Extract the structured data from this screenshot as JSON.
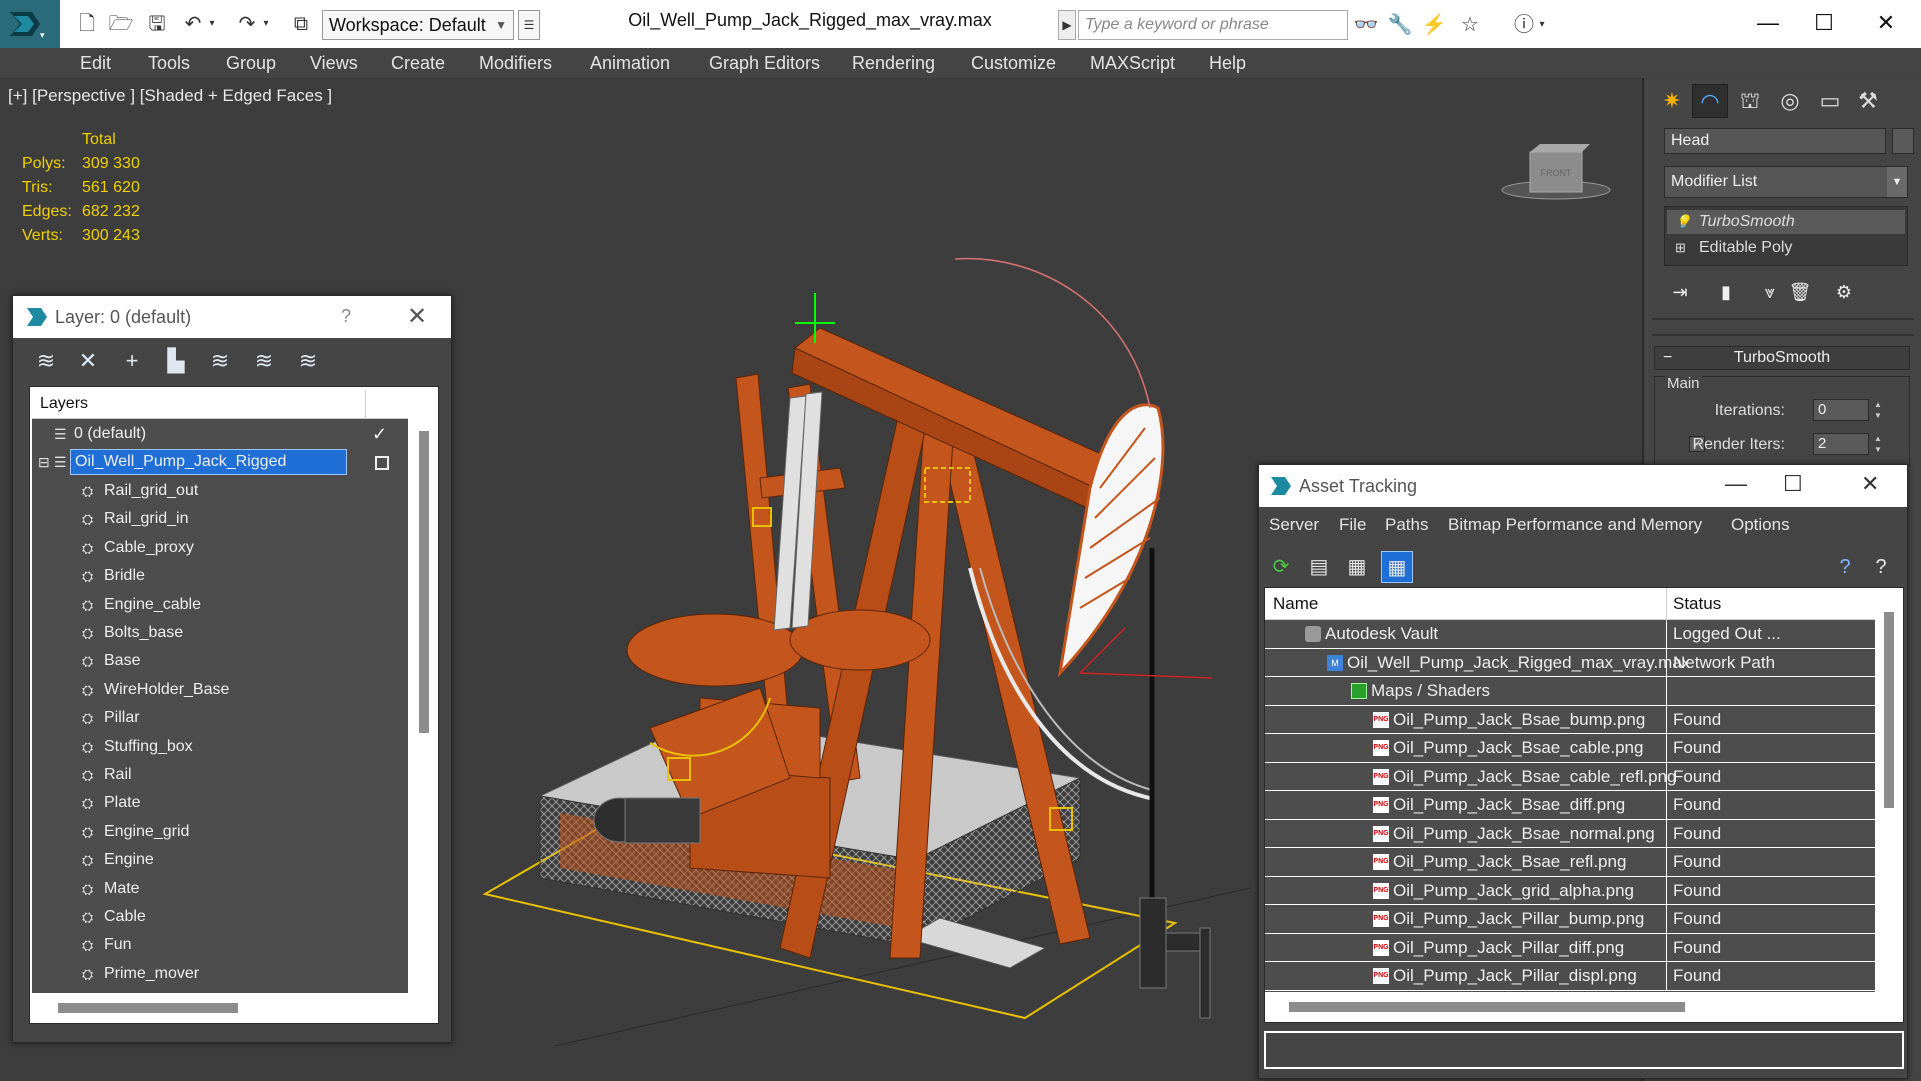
{
  "window": {
    "title": "Oil_Well_Pump_Jack_Rigged_max_vray.max",
    "workspace": "Workspace: Default",
    "search_placeholder": "Type a keyword or phrase"
  },
  "menu": [
    "Edit",
    "Tools",
    "Group",
    "Views",
    "Create",
    "Modifiers",
    "Animation",
    "Graph Editors",
    "Rendering",
    "Customize",
    "MAXScript",
    "Help"
  ],
  "viewport": {
    "label": "[+] [Perspective ] [Shaded + Edged Faces ]",
    "stats": {
      "total_label": "Total",
      "rows": [
        {
          "label": "Polys:",
          "value": "309 330"
        },
        {
          "label": "Tris:",
          "value": "561 620"
        },
        {
          "label": "Edges:",
          "value": "682 232"
        },
        {
          "label": "Verts:",
          "value": "300 243"
        }
      ]
    },
    "viewcube_text": "FRONT",
    "colors": {
      "stats": "#f0d000",
      "background": "#3d3d3d",
      "model": "#c4551c"
    }
  },
  "command_panel": {
    "object_name": "Head",
    "modifier_list": "Modifier List",
    "stack": [
      "TurboSmooth",
      "Editable Poly"
    ],
    "rollout_title": "TurboSmooth",
    "group_label": "Main",
    "iterations_label": "Iterations:",
    "iterations_value": "0",
    "render_iters_label": "Render Iters:",
    "render_iters_value": "2"
  },
  "layer_dialog": {
    "title": "Layer: 0 (default)",
    "help": "?",
    "column_header": "Layers",
    "default_layer": "0 (default)",
    "selected_layer": "Oil_Well_Pump_Jack_Rigged",
    "objects": [
      "Rail_grid_out",
      "Rail_grid_in",
      "Cable_proxy",
      "Bridle",
      "Engine_cable",
      "Bolts_base",
      "Base",
      "WireHolder_Base",
      "Pillar",
      "Stuffing_box",
      "Rail",
      "Plate",
      "Engine_grid",
      "Engine",
      "Mate",
      "Cable",
      "Fun",
      "Prime_mover"
    ]
  },
  "asset_dialog": {
    "title": "Asset Tracking",
    "menu": [
      "Server",
      "File",
      "Paths",
      "Bitmap Performance and Memory",
      "Options"
    ],
    "columns": [
      "Name",
      "Status"
    ],
    "rows": [
      {
        "name": "Autodesk Vault",
        "status": "Logged Out ...",
        "indent": 0,
        "icon": "vault-icon"
      },
      {
        "name": "Oil_Well_Pump_Jack_Rigged_max_vray.max",
        "status": "Network Path",
        "indent": 1,
        "icon": "max-file-icon"
      },
      {
        "name": "Maps / Shaders",
        "status": "",
        "indent": 2,
        "icon": "maps-icon"
      },
      {
        "name": "Oil_Pump_Jack_Bsae_bump.png",
        "status": "Found",
        "indent": 3,
        "icon": "png-icon"
      },
      {
        "name": "Oil_Pump_Jack_Bsae_cable.png",
        "status": "Found",
        "indent": 3,
        "icon": "png-icon"
      },
      {
        "name": "Oil_Pump_Jack_Bsae_cable_refl.png",
        "status": "Found",
        "indent": 3,
        "icon": "png-icon"
      },
      {
        "name": "Oil_Pump_Jack_Bsae_diff.png",
        "status": "Found",
        "indent": 3,
        "icon": "png-icon"
      },
      {
        "name": "Oil_Pump_Jack_Bsae_normal.png",
        "status": "Found",
        "indent": 3,
        "icon": "png-icon"
      },
      {
        "name": "Oil_Pump_Jack_Bsae_refl.png",
        "status": "Found",
        "indent": 3,
        "icon": "png-icon"
      },
      {
        "name": "Oil_Pump_Jack_grid_alpha.png",
        "status": "Found",
        "indent": 3,
        "icon": "png-icon"
      },
      {
        "name": "Oil_Pump_Jack_Pillar_bump.png",
        "status": "Found",
        "indent": 3,
        "icon": "png-icon"
      },
      {
        "name": "Oil_Pump_Jack_Pillar_diff.png",
        "status": "Found",
        "indent": 3,
        "icon": "png-icon"
      },
      {
        "name": "Oil_Pump_Jack_Pillar_displ.png",
        "status": "Found",
        "indent": 3,
        "icon": "png-icon"
      }
    ],
    "png_badge": "PNG"
  }
}
